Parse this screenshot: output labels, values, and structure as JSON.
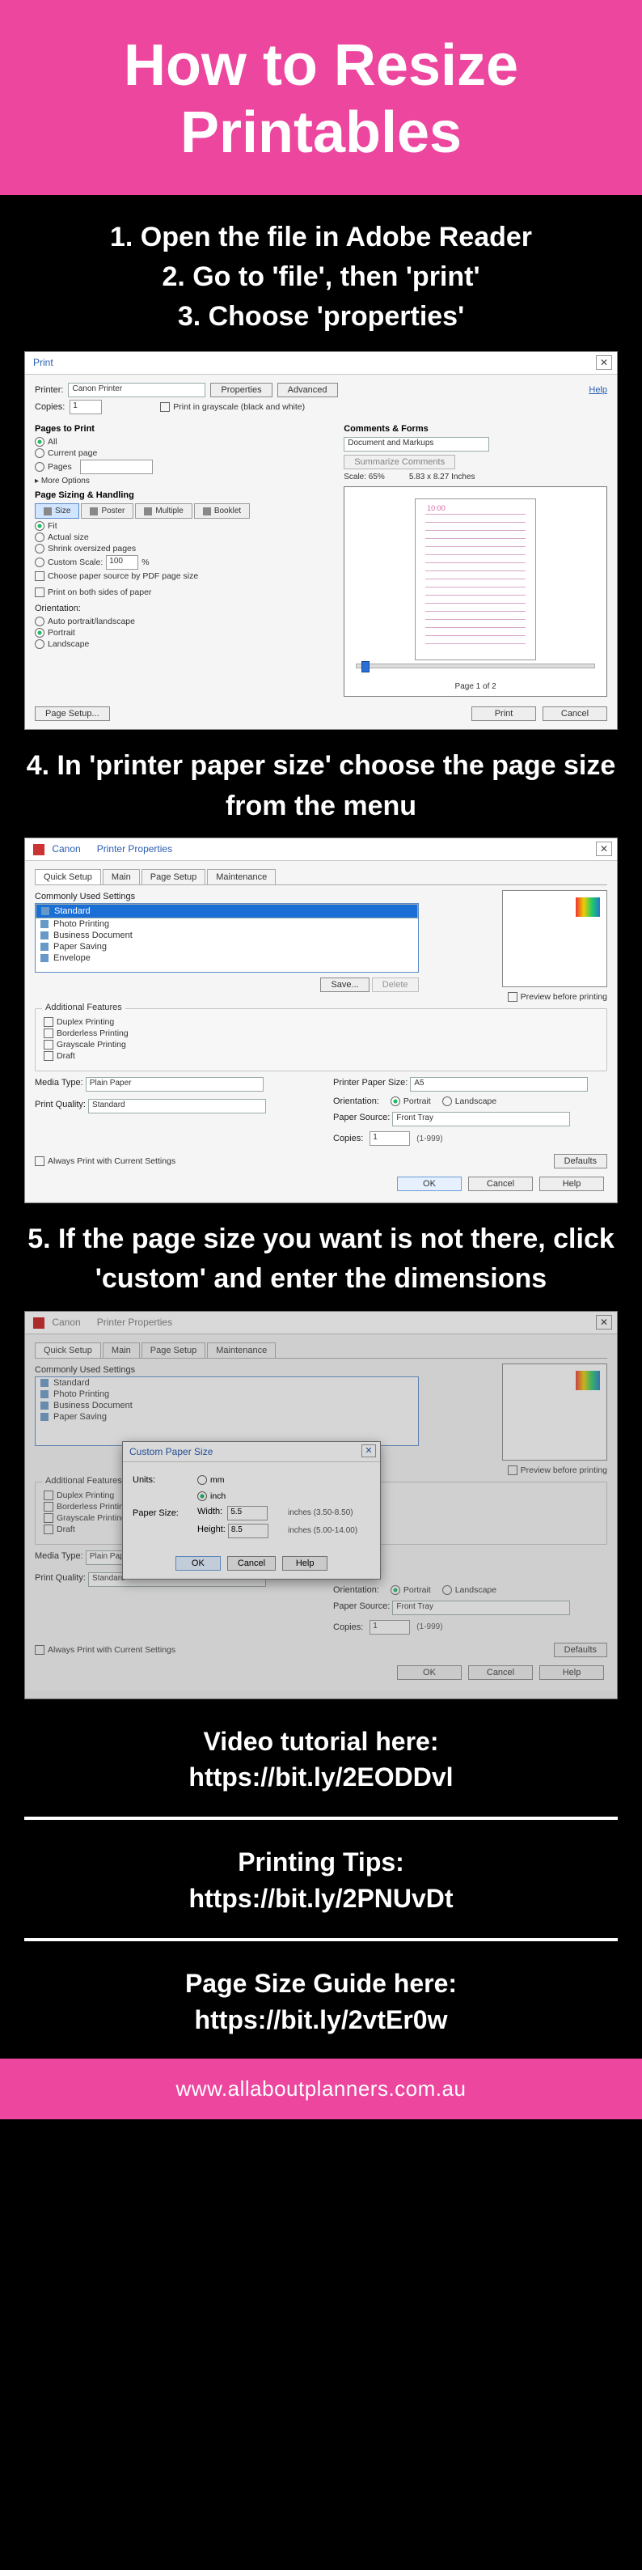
{
  "header": {
    "title_l1": "How to Resize",
    "title_l2": "Printables"
  },
  "steps": {
    "s1": "1. Open the file in Adobe Reader",
    "s2": "2. Go to 'file', then 'print'",
    "s3": "3. Choose 'properties'",
    "s4": "4. In 'printer paper size' choose the page size from the menu",
    "s5": "5. If the page size you want is not there, click 'custom' and enter the dimensions"
  },
  "print": {
    "title": "Print",
    "printer_lbl": "Printer:",
    "printer_val": "Canon            Printer",
    "copies_lbl": "Copies:",
    "copies_val": "1",
    "properties": "Properties",
    "advanced": "Advanced",
    "help": "Help",
    "grayscale": "Print in grayscale (black and white)",
    "ptp": "Pages to Print",
    "all": "All",
    "current": "Current page",
    "pages": "Pages",
    "more": "More Options",
    "sizing": "Page Sizing & Handling",
    "size": "Size",
    "poster": "Poster",
    "multiple": "Multiple",
    "booklet": "Booklet",
    "fit": "Fit",
    "actual": "Actual size",
    "shrink": "Shrink oversized pages",
    "customscale": "Custom Scale:",
    "customscale_val": "100",
    "pct": "%",
    "choose": "Choose paper source by PDF page size",
    "both": "Print on both sides of paper",
    "orientation": "Orientation:",
    "auto": "Auto portrait/landscape",
    "portrait": "Portrait",
    "landscape": "Landscape",
    "comments": "Comments & Forms",
    "docmark": "Document and Markups",
    "summarize": "Summarize Comments",
    "scale": "Scale:  65%",
    "dims": "5.83 x 8.27 Inches",
    "time": "10:00",
    "pgof": "Page 1 of 2",
    "pgsetup": "Page Setup...",
    "printbtn": "Print",
    "cancel": "Cancel"
  },
  "canon": {
    "app": "Canon",
    "title": "Printer Properties",
    "tabs": {
      "qs": "Quick Setup",
      "main": "Main",
      "ps": "Page Setup",
      "mnt": "Maintenance"
    },
    "used": "Commonly Used Settings",
    "items": {
      "std": "Standard",
      "photo": "Photo Printing",
      "biz": "Business Document",
      "save": "Paper Saving",
      "env": "Envelope"
    },
    "savebtn": "Save...",
    "delbtn": "Delete",
    "prevchk": "Preview before printing",
    "addl": "Additional Features",
    "dup": "Duplex Printing",
    "bless": "Borderless Printing",
    "gray": "Grayscale Printing",
    "draft": "Draft",
    "media": "Media Type:",
    "media_val": "Plain Paper",
    "pq": "Print Quality:",
    "pq_val": "Standard",
    "pps": "Printer Paper Size:",
    "pps_val": "A5",
    "orient": "Orientation:",
    "port": "Portrait",
    "land": "Landscape",
    "psrc": "Paper Source:",
    "psrc_val": "Front Tray",
    "copies": "Copies:",
    "copies_val": "1",
    "copies_range": "(1-999)",
    "always": "Always Print with Current Settings",
    "defaults": "Defaults",
    "ok": "OK",
    "cancel": "Cancel",
    "help": "Help"
  },
  "custom": {
    "title": "Custom Paper Size",
    "units": "Units:",
    "mm": "mm",
    "inch": "inch",
    "papersize": "Paper Size:",
    "width": "Width:",
    "height": "Height:",
    "w_val": "5.5",
    "w_range": "inches (3.50-8.50)",
    "h_val": "8.5",
    "h_range": "inches (5.00-14.00)",
    "ok": "OK",
    "cancel": "Cancel",
    "help": "Help"
  },
  "links": {
    "video_h": "Video tutorial here:",
    "video_u": "https://bit.ly/2EODDvl",
    "tips_h": "Printing Tips:",
    "tips_u": "https://bit.ly/2PNUvDt",
    "guide_h": "Page Size Guide here:",
    "guide_u": "https://bit.ly/2vtEr0w"
  },
  "footer": {
    "site": "www.allaboutplanners.com.au"
  },
  "icons": {
    "close": "✕",
    "dd": "▾",
    "tri": "▸"
  }
}
